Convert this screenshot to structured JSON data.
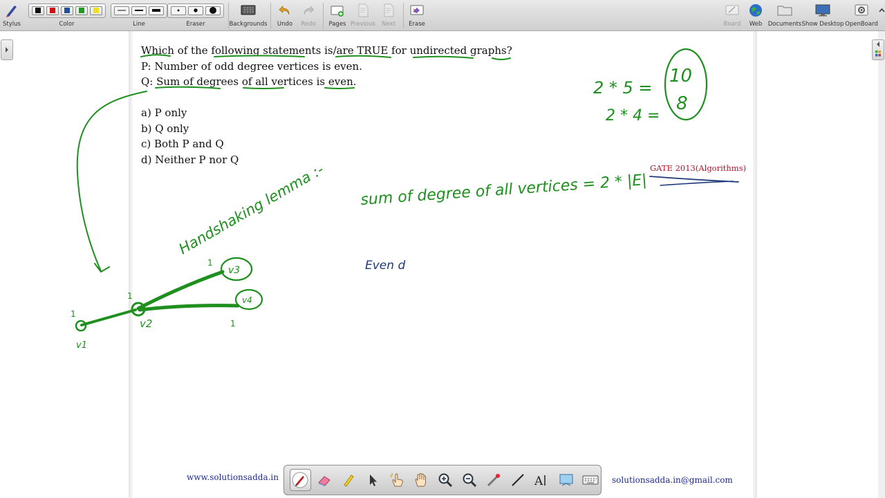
{
  "toolbar": {
    "stylus": "Stylus",
    "color": "Color",
    "line": "Line",
    "eraser": "Eraser",
    "backgrounds": "Backgrounds",
    "undo": "Undo",
    "redo": "Redo",
    "pages": "Pages",
    "previous": "Previous",
    "next": "Next",
    "erase": "Erase",
    "board": "Board",
    "web": "Web",
    "documents": "Documents",
    "show_desktop": "Show Desktop",
    "openboard": "OpenBoard",
    "colors": [
      "#111111",
      "#d01010",
      "#1e4f9a",
      "#1f9a1f",
      "#f0e020"
    ]
  },
  "question": {
    "title": "Which of the following statements is/are TRUE for undirected graphs?",
    "p": "P: Number of odd degree vertices is even.",
    "q": "Q: Sum of degrees of all vertices is even.",
    "options": [
      "a) P only",
      "b) Q only",
      "c) Both P and Q",
      "d) Neither P nor Q"
    ],
    "source": "GATE 2013(Algorithms)"
  },
  "ink": {
    "color": "#1f8f1f",
    "note_color": "#1d3a78",
    "handshaking": "Handshaking lemma :-",
    "formula": "sum of degree of all vertices = 2 * |E|",
    "calc_1": "2 * 5 =",
    "calc_1_result": "10",
    "calc_2": "2 * 4 =",
    "calc_2_result": "8",
    "even_note": "Even d",
    "vertices": [
      "v1",
      "v2",
      "v3",
      "v4"
    ],
    "degrees": [
      "1",
      "1",
      "1",
      "1"
    ]
  },
  "footer": {
    "website": "www.solutionsadda.in",
    "email": "solutionsadda.in@gmail.com"
  }
}
